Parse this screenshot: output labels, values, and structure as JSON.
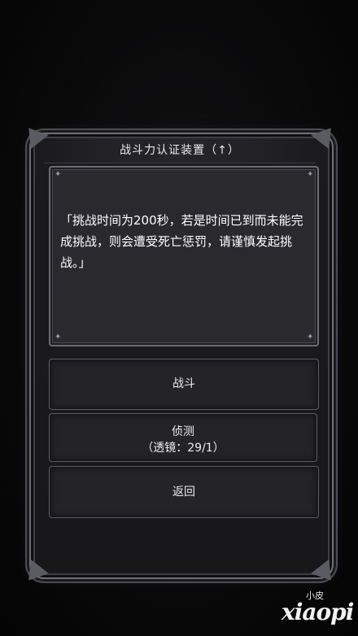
{
  "dialog": {
    "title": "战斗力认证装置（↑）",
    "message": "「挑战时间为200秒，若是时间已到而未能完成挑战，则会遭受死亡惩罚，请谨慎发起挑战。」"
  },
  "buttons": {
    "fight_label": "战斗",
    "detect_label": "侦测",
    "detect_sub": "（透镜：29/1）",
    "return_label": "返回"
  },
  "watermark": {
    "small": "小皮",
    "big": "xiaopi"
  }
}
